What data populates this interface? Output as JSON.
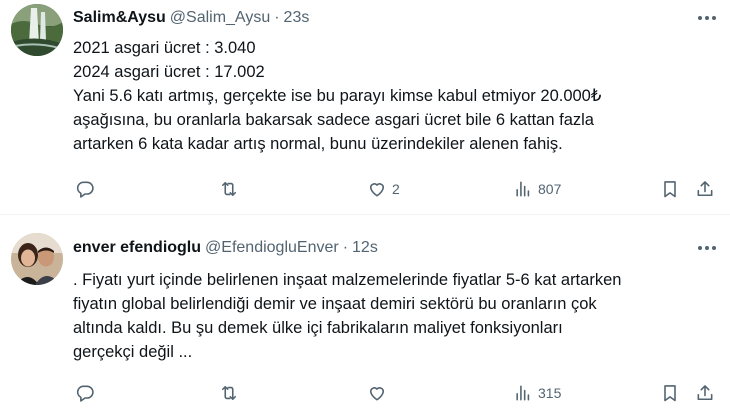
{
  "tweets": [
    {
      "author_name": "Salim&Aysu",
      "handle": "@Salim_Aysu",
      "separator": "·",
      "time": "23s",
      "lines": [
        "2021 asgari ücret : 3.040",
        "2024 asgari ücret : 17.002",
        "Yani 5.6 katı artmış, gerçekte ise bu parayı kimse kabul etmiyor 20.000₺",
        "aşağısına, bu oranlarla bakarsak sadece asgari ücret bile 6 kattan fazla",
        "artarken 6 kata kadar artış normal, bunu üzerindekiler alenen fahiş."
      ],
      "reply_count": "",
      "retweet_count": "",
      "like_count": "2",
      "view_count": "807"
    },
    {
      "author_name": "enver efendioglu",
      "handle": "@EfendiogluEnver",
      "separator": "·",
      "time": "12s",
      "lines": [
        ". Fiyatı yurt içinde belirlenen inşaat malzemelerinde fiyatlar 5-6 kat artarken",
        "fiyatın global belirlendiği demir ve inşaat demiri sektörü bu oranların çok",
        "altında kaldı. Bu şu demek ülke içi fabrikaların maliyet fonksiyonları",
        "gerçekçi değil ..."
      ],
      "reply_count": "",
      "retweet_count": "",
      "like_count": "",
      "view_count": "315"
    }
  ],
  "icons": {
    "reply": "reply-icon",
    "retweet": "retweet-icon",
    "like": "heart-icon",
    "views": "analytics-icon",
    "bookmark": "bookmark-icon",
    "share": "share-icon",
    "more": "more-icon"
  },
  "colors": {
    "text": "#0f1419",
    "secondary": "#536471",
    "divider": "#eff3f4"
  }
}
